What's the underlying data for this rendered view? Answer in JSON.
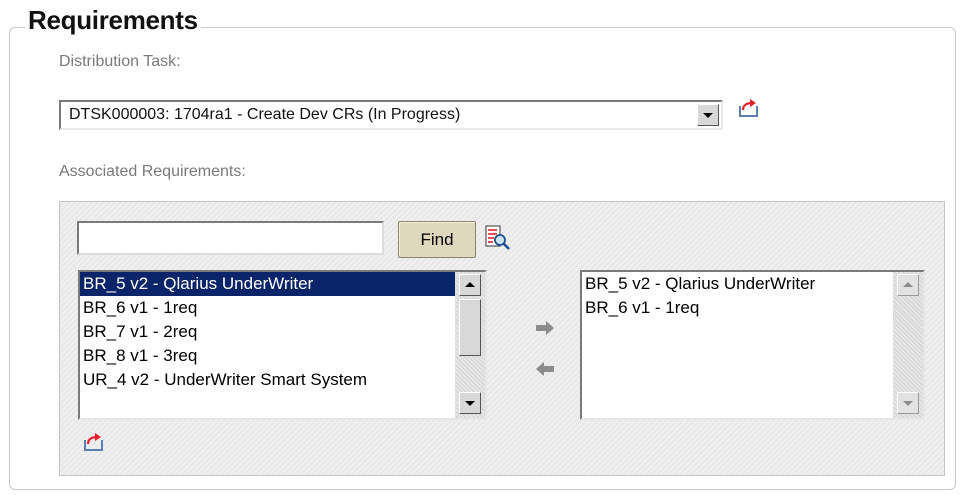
{
  "section": {
    "title": "Requirements"
  },
  "distribution": {
    "label": "Distribution Task:",
    "selected": "DTSK000003: 1704ra1 - Create Dev CRs (In Progress)",
    "dropdown_icon": "chevron-down-icon",
    "export_icon": "export-arrow-icon"
  },
  "associated": {
    "label": "Associated Requirements:",
    "find_input": {
      "value": "",
      "placeholder": ""
    },
    "find_button": "Find",
    "lookup_icon": "lookup-magnifier-icon",
    "available": [
      "BR_5 v2 - Qlarius UnderWriter",
      "BR_6 v1 - 1req",
      "BR_7 v1 - 2req",
      "BR_8 v1 - 3req",
      "UR_4 v2 - UnderWriter Smart System"
    ],
    "selected_available": "BR_5 v2 - Qlarius UnderWriter",
    "chosen": [
      "BR_5 v2 - Qlarius UnderWriter",
      "BR_6 v1 - 1req"
    ],
    "add_icon": "arrow-right-icon",
    "remove_icon": "arrow-left-icon",
    "export_icon": "export-arrow-icon"
  },
  "colors": {
    "selection": "#0a246a",
    "find_button": "#ded8bc",
    "export_arrow": "#e8202a"
  }
}
